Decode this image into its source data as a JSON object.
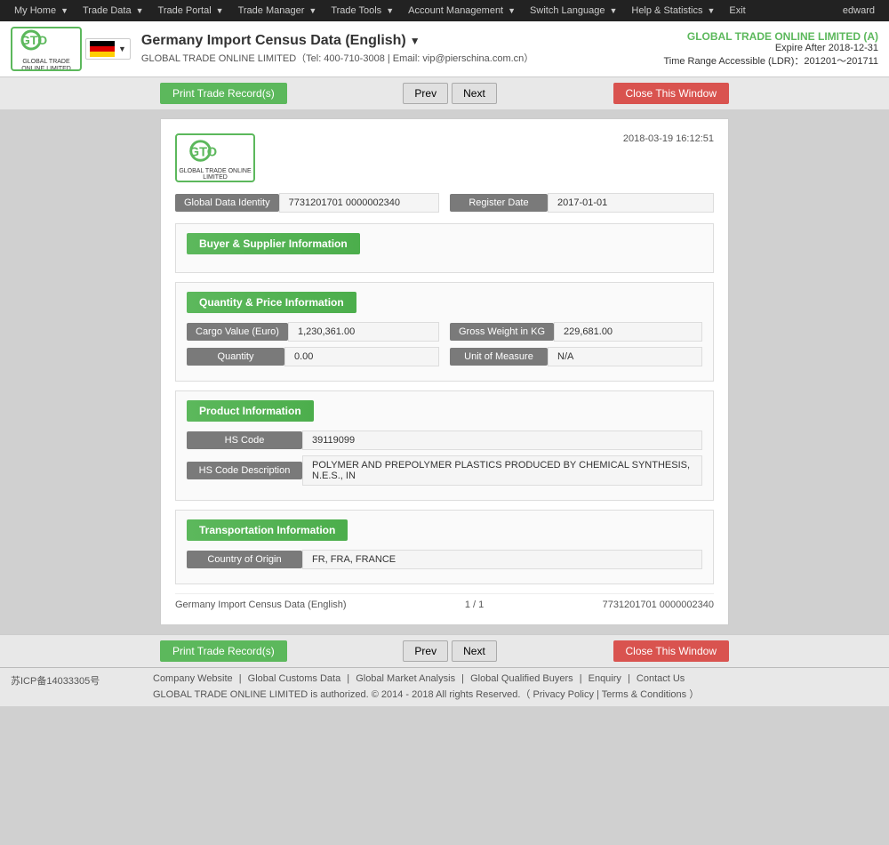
{
  "topnav": {
    "items": [
      {
        "label": "My Home",
        "id": "my-home"
      },
      {
        "label": "Trade Data",
        "id": "trade-data"
      },
      {
        "label": "Trade Portal",
        "id": "trade-portal"
      },
      {
        "label": "Trade Manager",
        "id": "trade-manager"
      },
      {
        "label": "Trade Tools",
        "id": "trade-tools"
      },
      {
        "label": "Account Management",
        "id": "account-management"
      },
      {
        "label": "Switch Language",
        "id": "switch-language"
      },
      {
        "label": "Help & Statistics",
        "id": "help-stats"
      },
      {
        "label": "Exit",
        "id": "exit"
      }
    ],
    "user": "edward"
  },
  "header": {
    "logo_line1": "GTO",
    "logo_line2": "GLOBAL TRADE ONLINE LIMITED",
    "flag_alt": "Germany flag",
    "title": "Germany Import Census Data (English)",
    "contact": "GLOBAL TRADE ONLINE LIMITED（Tel: 400-710-3008 | Email: vip@pierschina.com.cn）",
    "company_name": "GLOBAL TRADE ONLINE LIMITED (A)",
    "expire": "Expire After 2018-12-31",
    "time_range": "Time Range Accessible (LDR)：201201～201711"
  },
  "toolbar": {
    "print_label": "Print Trade Record(s)",
    "prev_label": "Prev",
    "next_label": "Next",
    "close_label": "Close This Window"
  },
  "record": {
    "timestamp": "2018-03-19 16:12:51",
    "logo_line1": "GTO",
    "logo_line2": "GLOBAL TRADE ONLINE LIMITED",
    "global_data_identity_label": "Global Data Identity",
    "global_data_identity_value": "7731201701 0000002340",
    "register_date_label": "Register Date",
    "register_date_value": "2017-01-01",
    "sections": {
      "buyer_supplier": {
        "title": "Buyer & Supplier Information",
        "fields": []
      },
      "quantity_price": {
        "title": "Quantity & Price Information",
        "fields": [
          {
            "label": "Cargo Value (Euro)",
            "value": "1,230,361.00"
          },
          {
            "label": "Gross Weight in KG",
            "value": "229,681.00"
          },
          {
            "label": "Quantity",
            "value": "0.00"
          },
          {
            "label": "Unit of Measure",
            "value": "N/A"
          }
        ]
      },
      "product": {
        "title": "Product Information",
        "fields": [
          {
            "label": "HS Code",
            "value": "39119099"
          },
          {
            "label": "HS Code Description",
            "value": "POLYMER AND PREPOLYMER PLASTICS PRODUCED BY CHEMICAL SYNTHESIS, N.E.S., IN"
          }
        ]
      },
      "transportation": {
        "title": "Transportation Information",
        "fields": [
          {
            "label": "Country of Origin",
            "value": "FR, FRA, FRANCE"
          }
        ]
      }
    },
    "footer": {
      "source": "Germany Import Census Data (English)",
      "page": "1 / 1",
      "id": "7731201701 0000002340"
    }
  },
  "footer": {
    "icp": "苏ICP备14033305号",
    "links": [
      "Company Website",
      "Global Customs Data",
      "Global Market Analysis",
      "Global Qualified Buyers",
      "Enquiry",
      "Contact Us"
    ],
    "copyright": "GLOBAL TRADE ONLINE LIMITED is authorized. © 2014 - 2018 All rights Reserved.（",
    "privacy": "Privacy Policy",
    "separator": "|",
    "terms": "Terms & Conditions",
    "close_bracket": "）"
  }
}
